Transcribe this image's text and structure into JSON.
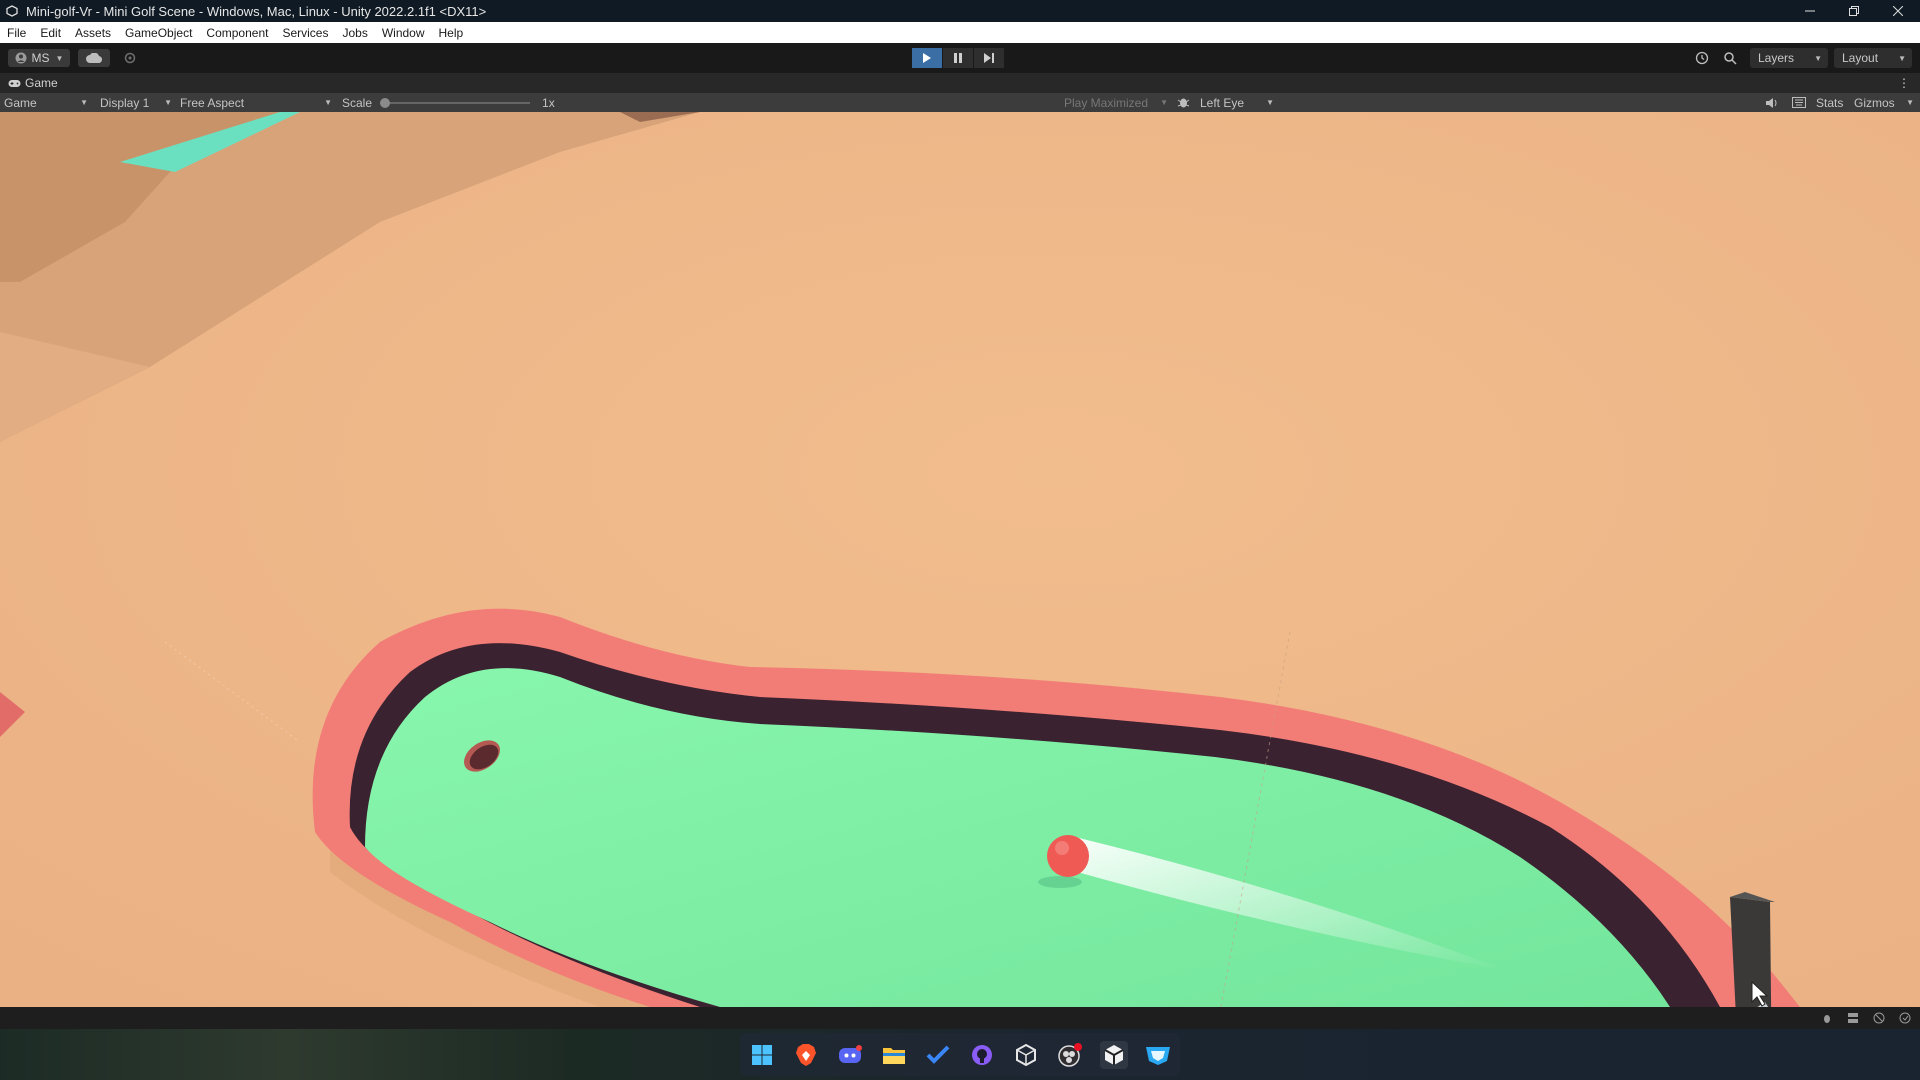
{
  "window": {
    "title": "Mini-golf-Vr - Mini Golf Scene - Windows, Mac, Linux - Unity 2022.2.1f1 <DX11>"
  },
  "menu": [
    "File",
    "Edit",
    "Assets",
    "GameObject",
    "Component",
    "Services",
    "Jobs",
    "Window",
    "Help"
  ],
  "toolbar": {
    "account_label": "MS",
    "layers_label": "Layers",
    "layout_label": "Layout"
  },
  "tab": {
    "label": "Game"
  },
  "gamebar": {
    "mode": "Game",
    "display": "Display 1",
    "aspect": "Free Aspect",
    "scale_label": "Scale",
    "scale_value": "1x",
    "play_mode": "Play Maximized",
    "eye": "Left Eye",
    "stats_label": "Stats",
    "gizmos_label": "Gizmos"
  },
  "taskbar": {
    "apps": [
      "windows-start-icon",
      "brave-browser-icon",
      "discord-icon",
      "file-explorer-icon",
      "todo-icon",
      "github-desktop-icon",
      "unity-hub-icon",
      "obs-icon",
      "unity-editor-icon",
      "vpn-shield-icon"
    ]
  },
  "colors": {
    "sand": "#f1b98a",
    "green": "#7cefa6",
    "rail": "#f27a75",
    "ball": "#f05a55"
  }
}
